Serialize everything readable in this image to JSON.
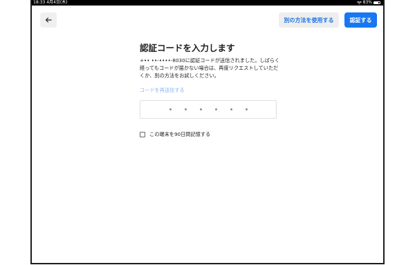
{
  "statusbar": {
    "time": "18:33  4月4日(木)",
    "battery": "83%"
  },
  "header": {
    "back_icon": "arrow-left-icon",
    "alt_method_label": "別の方法を使用する",
    "verify_label": "認証する",
    "accent_color": "#1877f2"
  },
  "main": {
    "title": "認証コードを入力します",
    "description": "+•• ••-••••-8030に認証コードが送信されました。しばらく経ってもコードが届かない場合は、再度リクエストしていただくか、別の方法をお試しください。",
    "resend_link": "コードを再送信する",
    "code_placeholder": "• • • • • •",
    "remember_label": "この端末を90日間記憶する"
  }
}
